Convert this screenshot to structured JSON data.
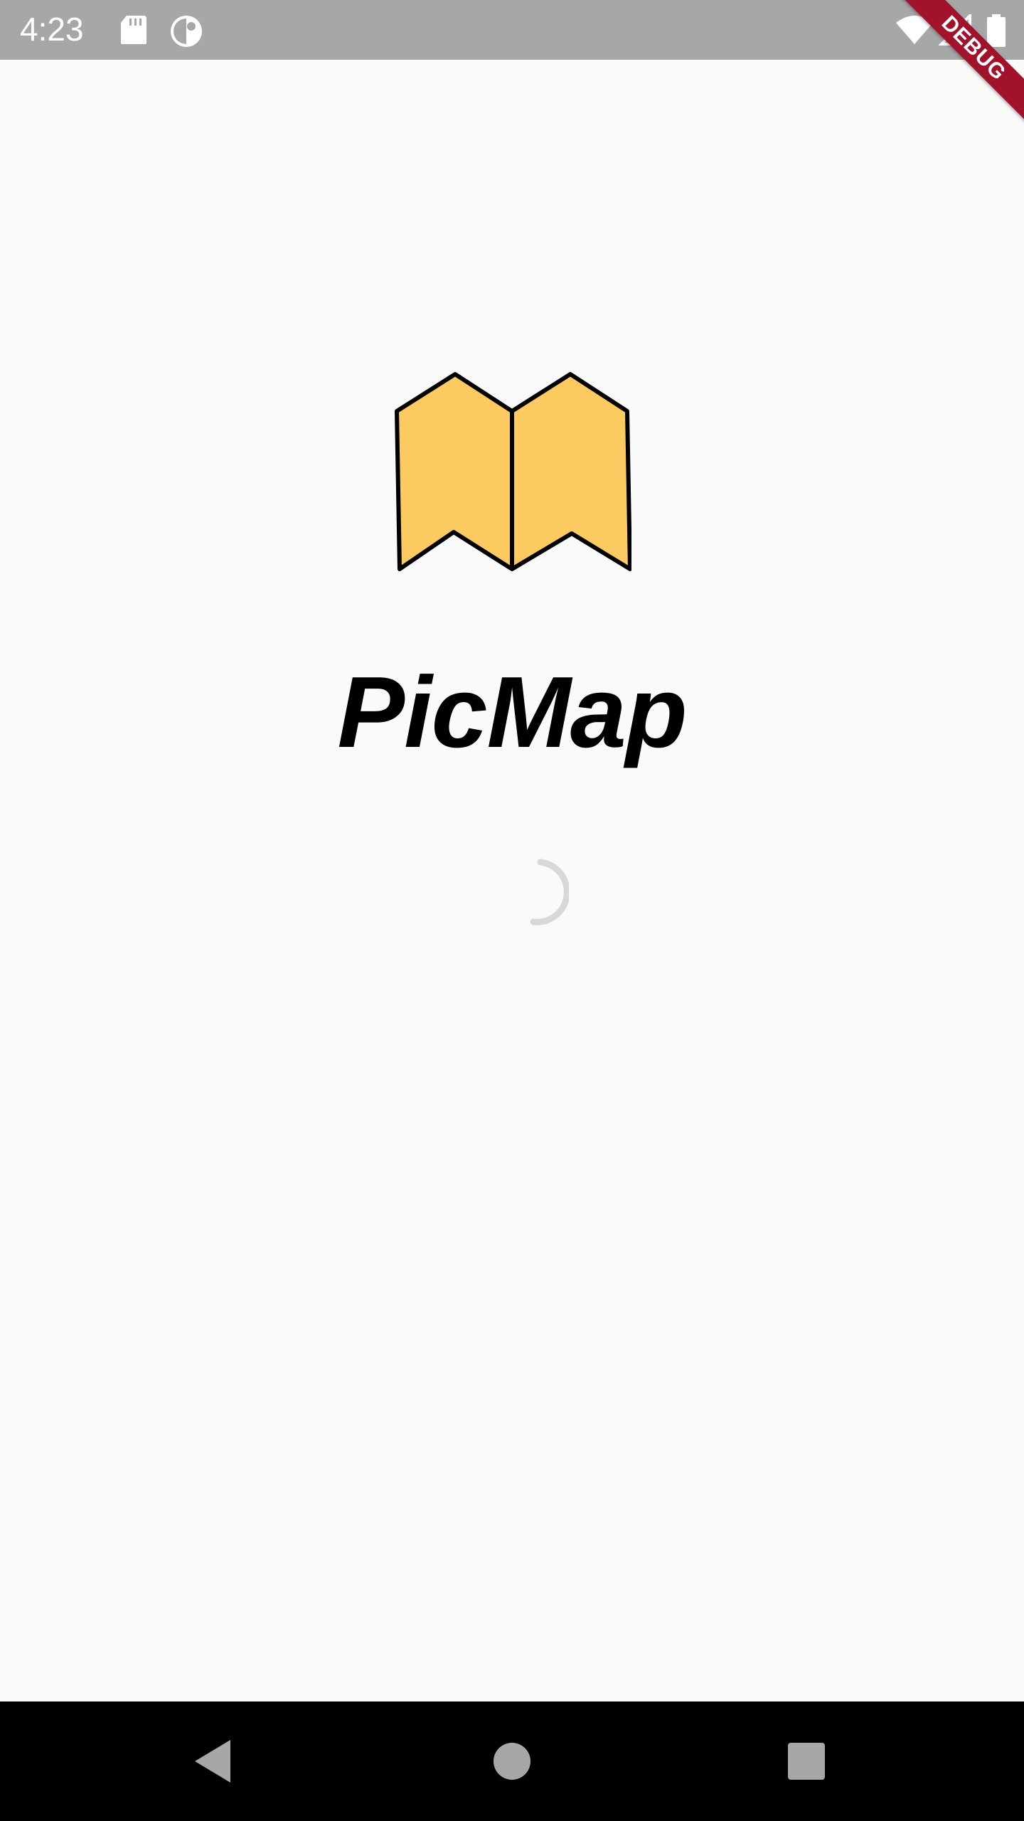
{
  "status_bar": {
    "time": "4:23",
    "icons": [
      "sd-card-icon",
      "flux-icon",
      "wifi-icon",
      "signal-icon",
      "battery-icon"
    ]
  },
  "debug_banner": {
    "label": "DEBUG"
  },
  "app": {
    "logo_icon": "folded-map-icon",
    "title": "PicMap",
    "loading_indicator": "progress-spinner-icon"
  },
  "navigation_bar": {
    "buttons": [
      "back-icon",
      "home-icon",
      "recents-icon"
    ]
  },
  "colors": {
    "status_bar": "#a7a7a7",
    "background": "#fafafa",
    "map_fill": "#fbcb62",
    "debug_banner": "#a0132a",
    "nav_bar": "#000000"
  }
}
